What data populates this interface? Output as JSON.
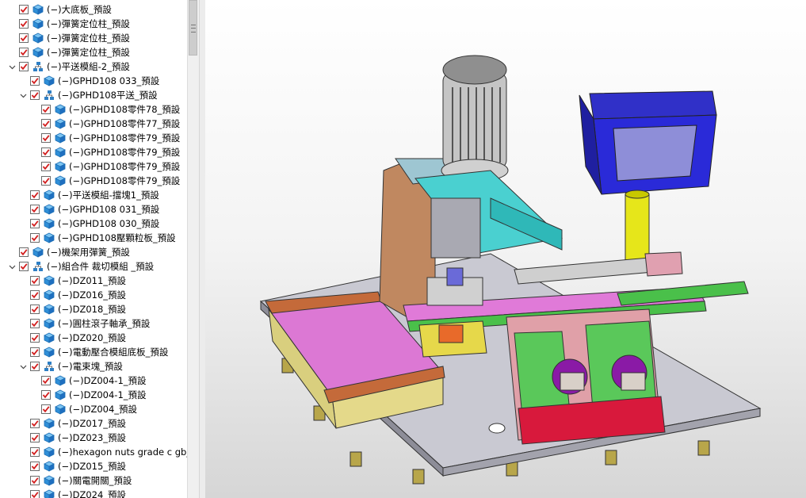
{
  "tree": {
    "items": [
      {
        "label": "(−)大底板_預設",
        "depth": 1,
        "expand": "",
        "icon": "part",
        "checked": true
      },
      {
        "label": "(−)彈簧定位柱_預設",
        "depth": 1,
        "expand": "",
        "icon": "part",
        "checked": true
      },
      {
        "label": "(−)彈簧定位柱_預設",
        "depth": 1,
        "expand": "",
        "icon": "part",
        "checked": true
      },
      {
        "label": "(−)彈簧定位柱_預設",
        "depth": 1,
        "expand": "",
        "icon": "part",
        "checked": true
      },
      {
        "label": "(−)平送模組-2_預設",
        "depth": 1,
        "expand": "open",
        "icon": "assembly",
        "checked": true
      },
      {
        "label": "(−)GPHD108 033_預設",
        "depth": 2,
        "expand": "",
        "icon": "part",
        "checked": true
      },
      {
        "label": "(−)GPHD108平送_預設",
        "depth": 2,
        "expand": "open",
        "icon": "assembly",
        "checked": true
      },
      {
        "label": "(−)GPHD108零件78_預設",
        "depth": 3,
        "expand": "",
        "icon": "part",
        "checked": true
      },
      {
        "label": "(−)GPHD108零件77_預設",
        "depth": 3,
        "expand": "",
        "icon": "part",
        "checked": true
      },
      {
        "label": "(−)GPHD108零件79_預設",
        "depth": 3,
        "expand": "",
        "icon": "part",
        "checked": true
      },
      {
        "label": "(−)GPHD108零件79_預設",
        "depth": 3,
        "expand": "",
        "icon": "part",
        "checked": true
      },
      {
        "label": "(−)GPHD108零件79_預設",
        "depth": 3,
        "expand": "",
        "icon": "part",
        "checked": true
      },
      {
        "label": "(−)GPHD108零件79_預設",
        "depth": 3,
        "expand": "",
        "icon": "part",
        "checked": true
      },
      {
        "label": "(−)平送模組-擋塊1_預設",
        "depth": 2,
        "expand": "",
        "icon": "part",
        "checked": true
      },
      {
        "label": "(−)GPHD108 031_預設",
        "depth": 2,
        "expand": "",
        "icon": "part",
        "checked": true
      },
      {
        "label": "(−)GPHD108 030_預設",
        "depth": 2,
        "expand": "",
        "icon": "part",
        "checked": true
      },
      {
        "label": "(−)GPHD108壓顆粒板_預設",
        "depth": 2,
        "expand": "",
        "icon": "part",
        "checked": true
      },
      {
        "label": "(−)機架用彈簧_預設",
        "depth": 1,
        "expand": "",
        "icon": "part",
        "checked": true
      },
      {
        "label": "(−)組合件 裁切模組 _預設",
        "depth": 1,
        "expand": "open",
        "icon": "assembly",
        "checked": true
      },
      {
        "label": "(−)DZ011_預設",
        "depth": 2,
        "expand": "",
        "icon": "part",
        "checked": true
      },
      {
        "label": "(−)DZ016_預設",
        "depth": 2,
        "expand": "",
        "icon": "part",
        "checked": true
      },
      {
        "label": "(−)DZ018_預設",
        "depth": 2,
        "expand": "",
        "icon": "part",
        "checked": true
      },
      {
        "label": "(−)圓柱滾子軸承_預設",
        "depth": 2,
        "expand": "",
        "icon": "part",
        "checked": true
      },
      {
        "label": "(−)DZ020_預設",
        "depth": 2,
        "expand": "",
        "icon": "part",
        "checked": true
      },
      {
        "label": "(−)電動壓合模組底板_預設",
        "depth": 2,
        "expand": "",
        "icon": "part",
        "checked": true
      },
      {
        "label": "(−)電束塊_預設",
        "depth": 2,
        "expand": "open",
        "icon": "assembly",
        "checked": true
      },
      {
        "label": "(−)DZ004-1_預設",
        "depth": 3,
        "expand": "",
        "icon": "part",
        "checked": true
      },
      {
        "label": "(−)DZ004-1_預設",
        "depth": 3,
        "expand": "",
        "icon": "part",
        "checked": true
      },
      {
        "label": "(−)DZ004_預設",
        "depth": 3,
        "expand": "",
        "icon": "part",
        "checked": true
      },
      {
        "label": "(−)DZ017_預設",
        "depth": 2,
        "expand": "",
        "icon": "part",
        "checked": true
      },
      {
        "label": "(−)DZ023_預設",
        "depth": 2,
        "expand": "",
        "icon": "part",
        "checked": true
      },
      {
        "label": "(−)hexagon nuts grade c gb_G",
        "depth": 2,
        "expand": "",
        "icon": "part",
        "checked": true
      },
      {
        "label": "(−)DZ015_預設",
        "depth": 2,
        "expand": "",
        "icon": "part",
        "checked": true
      },
      {
        "label": "(−)關電開關_預設",
        "depth": 2,
        "expand": "",
        "icon": "part",
        "checked": true
      },
      {
        "label": "(−)DZ024_預設",
        "depth": 2,
        "expand": "",
        "icon": "part",
        "checked": true
      }
    ]
  },
  "colors": {
    "check": "#d21f1f",
    "part_icon": "#2f8fd8",
    "assembly_icon": "#2f7fc4"
  },
  "icons": {
    "part": "cube-part-icon",
    "assembly": "assembly-tree-icon",
    "open": "chevron-down-icon"
  }
}
